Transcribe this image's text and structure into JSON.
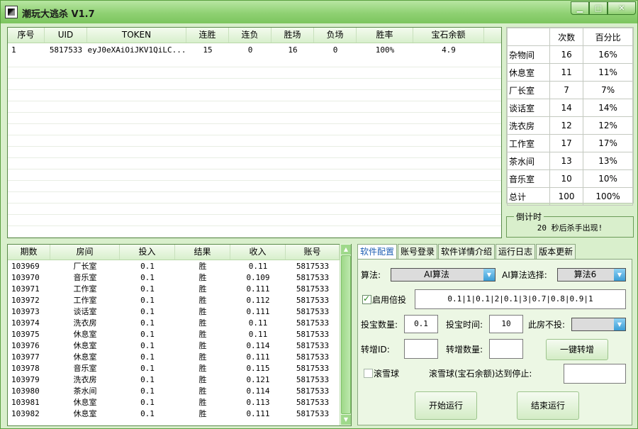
{
  "window": {
    "title": "潮玩大逃杀 V1.7"
  },
  "accounts": {
    "columns": [
      "序号",
      "UID",
      "TOKEN",
      "连胜",
      "连负",
      "胜场",
      "负场",
      "胜率",
      "宝石余额"
    ],
    "rows": [
      [
        "1",
        "5817533",
        "eyJ0eXAiOiJKV1QiLC...",
        "15",
        "0",
        "16",
        "0",
        "100%",
        "4.9"
      ]
    ]
  },
  "stats": {
    "headers": [
      "次数",
      "百分比"
    ],
    "rows": [
      [
        "杂物间",
        "16",
        "16%"
      ],
      [
        "休息室",
        "11",
        "11%"
      ],
      [
        "厂长室",
        "7",
        "7%"
      ],
      [
        "谈话室",
        "14",
        "14%"
      ],
      [
        "洗衣房",
        "12",
        "12%"
      ],
      [
        "工作室",
        "17",
        "17%"
      ],
      [
        "茶水间",
        "13",
        "13%"
      ],
      [
        "音乐室",
        "10",
        "10%"
      ],
      [
        "总计",
        "100",
        "100%"
      ]
    ]
  },
  "countdown": {
    "legend": "倒计时",
    "message": "20 秒后杀手出现!"
  },
  "history": {
    "columns": [
      "期数",
      "房间",
      "投入",
      "结果",
      "收入",
      "账号"
    ],
    "rows": [
      [
        "103969",
        "厂长室",
        "0.1",
        "胜",
        "0.11",
        "5817533"
      ],
      [
        "103970",
        "音乐室",
        "0.1",
        "胜",
        "0.109",
        "5817533"
      ],
      [
        "103971",
        "工作室",
        "0.1",
        "胜",
        "0.111",
        "5817533"
      ],
      [
        "103972",
        "工作室",
        "0.1",
        "胜",
        "0.112",
        "5817533"
      ],
      [
        "103973",
        "谈话室",
        "0.1",
        "胜",
        "0.111",
        "5817533"
      ],
      [
        "103974",
        "洗衣房",
        "0.1",
        "胜",
        "0.11",
        "5817533"
      ],
      [
        "103975",
        "休息室",
        "0.1",
        "胜",
        "0.11",
        "5817533"
      ],
      [
        "103976",
        "休息室",
        "0.1",
        "胜",
        "0.114",
        "5817533"
      ],
      [
        "103977",
        "休息室",
        "0.1",
        "胜",
        "0.111",
        "5817533"
      ],
      [
        "103978",
        "音乐室",
        "0.1",
        "胜",
        "0.115",
        "5817533"
      ],
      [
        "103979",
        "洗衣房",
        "0.1",
        "胜",
        "0.121",
        "5817533"
      ],
      [
        "103980",
        "茶水间",
        "0.1",
        "胜",
        "0.114",
        "5817533"
      ],
      [
        "103981",
        "休息室",
        "0.1",
        "胜",
        "0.113",
        "5817533"
      ],
      [
        "103982",
        "休息室",
        "0.1",
        "胜",
        "0.111",
        "5817533"
      ]
    ]
  },
  "tabs": [
    "软件配置",
    "账号登录",
    "软件详情介绍",
    "运行日志",
    "版本更新"
  ],
  "config": {
    "algo_label": "算法:",
    "algo_value": "AI算法",
    "ai_algo_label": "AI算法选择:",
    "ai_algo_value": "算法6",
    "multiplier_label": "启用倍投",
    "multiplier_checked": true,
    "multiplier_sequence": "0.1|1|0.1|2|0.1|3|0.7|0.8|0.9|1",
    "bet_amount_label": "投宝数量:",
    "bet_amount_value": "0.1",
    "bet_time_label": "投宝时间:",
    "bet_time_value": "10",
    "skip_room_label": "此房不投:",
    "skip_room_value": "",
    "transfer_id_label": "转增ID:",
    "transfer_id_value": "",
    "transfer_qty_label": "转增数量:",
    "transfer_qty_value": "",
    "transfer_button": "一键转增",
    "snowball_label": "滚雪球",
    "snowball_checked": false,
    "stop_label": "滚雪球(宝石余额)达到停止:",
    "stop_value": "",
    "start_button": "开始运行",
    "stop_button": "结束运行"
  }
}
